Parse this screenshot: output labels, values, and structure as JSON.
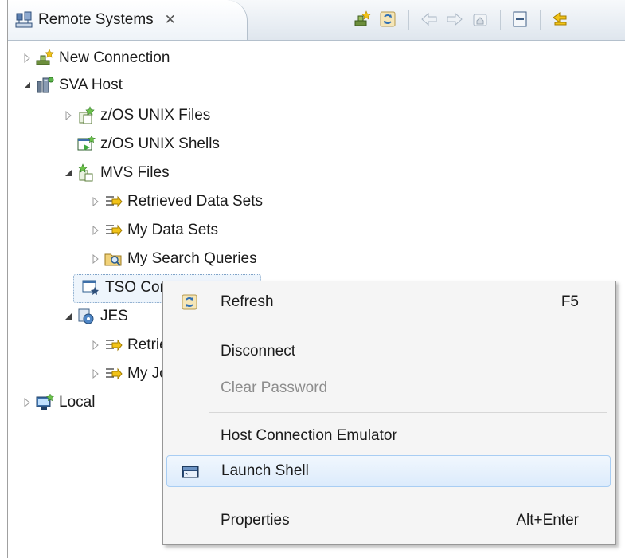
{
  "tab": {
    "title": "Remote Systems",
    "close_glyph": "✕"
  },
  "toolbar": [
    {
      "icon": "new-connection-icon"
    },
    {
      "icon": "refresh-icon"
    },
    {
      "icon": "back-arrow-icon"
    },
    {
      "icon": "forward-arrow-icon"
    },
    {
      "icon": "home-icon"
    },
    {
      "icon": "collapse-all-icon"
    },
    {
      "icon": "link-icon"
    }
  ],
  "tree": [
    {
      "label": "New Connection",
      "icon": "new-connection-icon",
      "expander": "collapsed"
    },
    {
      "label": "SVA Host",
      "icon": "host-icon",
      "expander": "expanded"
    },
    {
      "label": "z/OS UNIX Files",
      "icon": "unix-files-icon",
      "expander": "collapsed"
    },
    {
      "label": "z/OS UNIX Shells",
      "icon": "unix-shells-icon",
      "expander": "none"
    },
    {
      "label": "MVS Files",
      "icon": "mvs-files-icon",
      "expander": "expanded"
    },
    {
      "label": "Retrieved Data Sets",
      "icon": "data-sets-icon",
      "expander": "collapsed"
    },
    {
      "label": "My Data Sets",
      "icon": "data-sets-icon",
      "expander": "collapsed"
    },
    {
      "label": "My Search Queries",
      "icon": "search-queries-icon",
      "expander": "collapsed"
    },
    {
      "label": "TSO Commands",
      "icon": "tso-commands-icon",
      "expander": "none"
    },
    {
      "label": "JES",
      "icon": "jes-icon",
      "expander": "expanded"
    },
    {
      "label": "Retrieved Jobs",
      "icon": "data-sets-icon",
      "expander": "collapsed"
    },
    {
      "label": "My Jobs",
      "icon": "data-sets-icon",
      "expander": "collapsed"
    },
    {
      "label": "Local",
      "icon": "local-icon",
      "expander": "collapsed"
    }
  ],
  "context_menu": {
    "items": [
      {
        "label": "Refresh",
        "shortcut": "F5",
        "icon": "refresh-icon",
        "enabled": true
      },
      {
        "label": "Disconnect",
        "shortcut": "",
        "enabled": true
      },
      {
        "label": "Clear Password",
        "shortcut": "",
        "enabled": false
      },
      {
        "label": "Host Connection Emulator",
        "shortcut": "",
        "enabled": true
      },
      {
        "label": "Launch Shell",
        "shortcut": "",
        "icon": "shell-icon",
        "enabled": true,
        "highlighted": true
      },
      {
        "label": "Properties",
        "shortcut": "Alt+Enter",
        "enabled": true
      }
    ]
  },
  "colors": {
    "menu_highlight": "#dcebfc",
    "tab_background": "#eef3f8",
    "disabled_text": "#8d8d8d"
  }
}
